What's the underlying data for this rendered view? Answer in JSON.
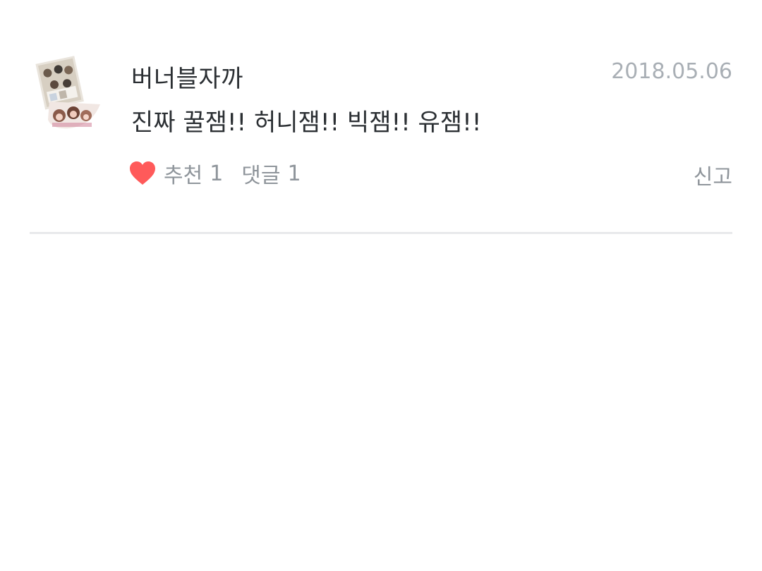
{
  "comment": {
    "author": "버너블자까",
    "date": "2018.05.06",
    "text": "진짜 꿀잼!! 허니잼!! 빅잼!! 유잼!!",
    "like_label": "추천",
    "like_count": "1",
    "reply_label": "댓글",
    "reply_count": "1",
    "report_label": "신고",
    "like_icon": "heart-icon",
    "like_color": "#ff5a5a"
  }
}
